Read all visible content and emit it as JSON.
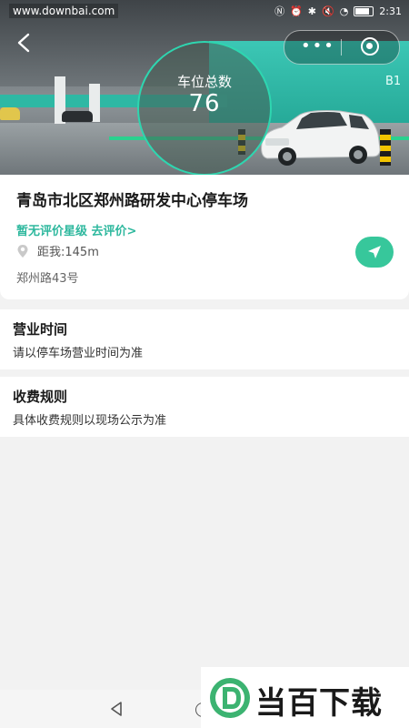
{
  "status_bar": {
    "watermark_url": "www.downbai.com",
    "time": "2:31"
  },
  "hero": {
    "level_sign": "B1",
    "spaces_label": "车位总数",
    "spaces_count": "76"
  },
  "lot": {
    "name": "青岛市北区郑州路研发中心停车场",
    "rating_text": "暂无评价星级 去评价>",
    "distance": "距我:145m",
    "address": "郑州路43号"
  },
  "hours": {
    "title": "营业时间",
    "desc": "请以停车场营业时间为准"
  },
  "fees": {
    "title": "收费规则",
    "desc": "具体收费规则以现场公示为准"
  },
  "watermark": {
    "brand": "当百下载"
  },
  "colors": {
    "accent": "#2eb89e",
    "nav_button": "#37c79b"
  }
}
